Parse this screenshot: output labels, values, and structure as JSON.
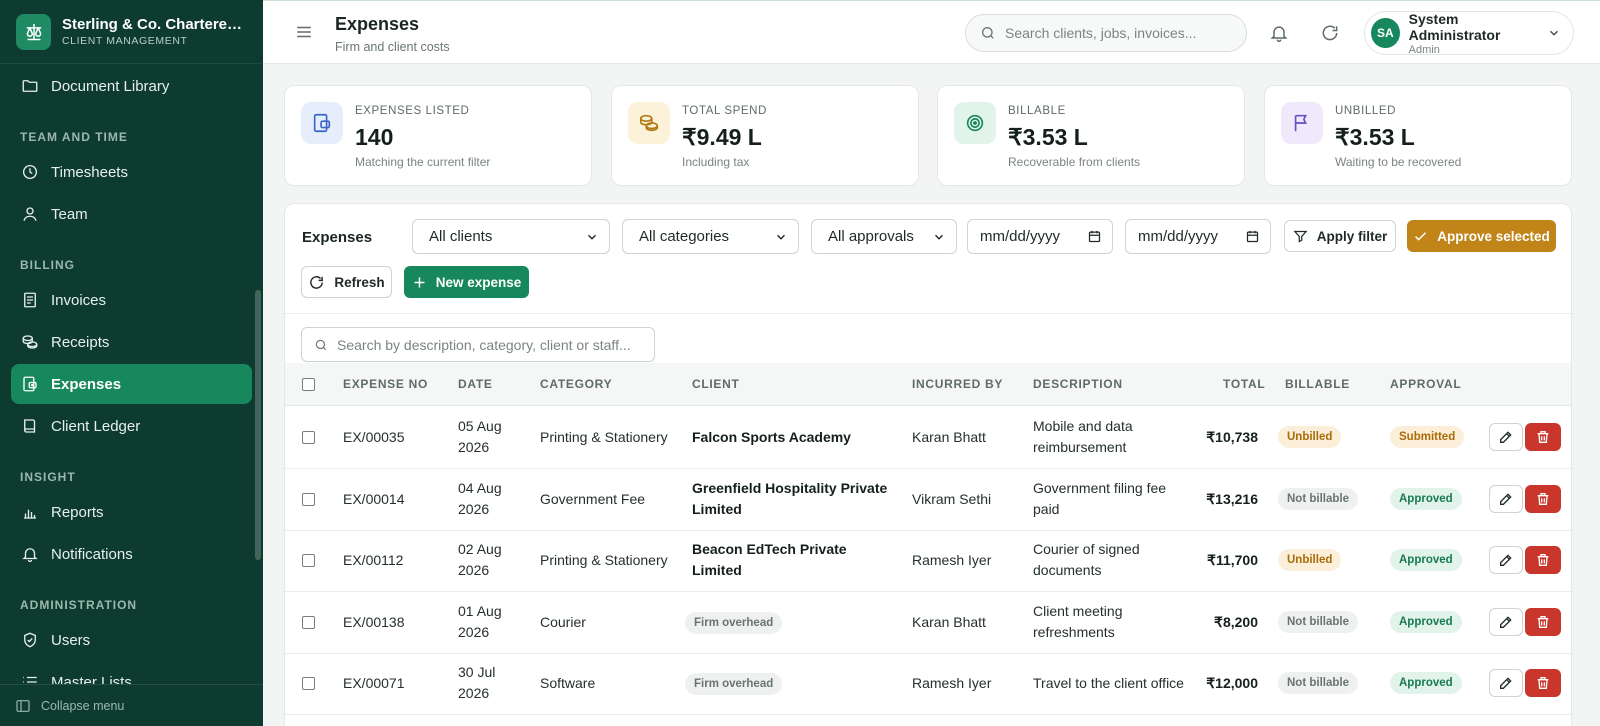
{
  "brand": {
    "title": "Sterling & Co. Chartered Accountants",
    "subtitle": "CLIENT MANAGEMENT"
  },
  "sidebar": {
    "top_item": {
      "label": "Document Library",
      "icon": "folder-icon"
    },
    "sections": [
      {
        "heading": "TEAM AND TIME",
        "items": [
          {
            "label": "Timesheets",
            "icon": "clock-icon"
          },
          {
            "label": "Team",
            "icon": "user-icon"
          }
        ]
      },
      {
        "heading": "BILLING",
        "items": [
          {
            "label": "Invoices",
            "icon": "invoice-icon"
          },
          {
            "label": "Receipts",
            "icon": "coins-icon"
          },
          {
            "label": "Expenses",
            "icon": "wallet-icon",
            "active": true
          },
          {
            "label": "Client Ledger",
            "icon": "book-icon"
          }
        ]
      },
      {
        "heading": "INSIGHT",
        "items": [
          {
            "label": "Reports",
            "icon": "bar-chart-icon"
          },
          {
            "label": "Notifications",
            "icon": "bell-icon"
          }
        ]
      },
      {
        "heading": "ADMINISTRATION",
        "items": [
          {
            "label": "Users",
            "icon": "shield-icon"
          },
          {
            "label": "Master Lists",
            "icon": "list-icon"
          }
        ]
      }
    ],
    "collapse_label": "Collapse menu"
  },
  "header": {
    "title": "Expenses",
    "subtitle": "Firm and client costs",
    "search_placeholder": "Search clients, jobs, invoices...",
    "user_name": "System Administrator",
    "user_role": "Admin",
    "user_initials": "SA"
  },
  "stats": [
    {
      "label": "EXPENSES LISTED",
      "value": "140",
      "note": "Matching the current filter",
      "icon": "wallet-icon",
      "tint": "#e6eefc",
      "color": "#3a64c8"
    },
    {
      "label": "TOTAL SPEND",
      "value": "₹9.49 L",
      "note": "Including tax",
      "icon": "coins-icon",
      "tint": "#fcf1d9",
      "color": "#b07a12"
    },
    {
      "label": "BILLABLE",
      "value": "₹3.53 L",
      "note": "Recoverable from clients",
      "icon": "target-icon",
      "tint": "#e1f3ea",
      "color": "#17875e"
    },
    {
      "label": "UNBILLED",
      "value": "₹3.53 L",
      "note": "Waiting to be recovered",
      "icon": "flag-icon",
      "tint": "#efe9fb",
      "color": "#6a4fc4"
    }
  ],
  "filters": {
    "panel_title": "Expenses",
    "client": "All clients",
    "category": "All categories",
    "approval": "All approvals",
    "date_from": "mm/dd/yyyy",
    "date_to": "mm/dd/yyyy",
    "apply_label": "Apply filter",
    "approve_label": "Approve selected",
    "refresh_label": "Refresh",
    "new_label": "New expense",
    "search_placeholder": "Search by description, category, client or staff..."
  },
  "table": {
    "columns": {
      "expense_no": "EXPENSE NO",
      "date": "DATE",
      "category": "CATEGORY",
      "client": "CLIENT",
      "incurred_by": "INCURRED BY",
      "description": "DESCRIPTION",
      "total": "TOTAL",
      "billable": "BILLABLE",
      "approval": "APPROVAL"
    },
    "rows": [
      {
        "no": "EX/00035",
        "date1": "05 Aug",
        "date2": "2026",
        "category": "Printing & Stationery",
        "client1": "Falcon Sports Academy",
        "client2": "",
        "client_overhead": false,
        "by": "Karan Bhatt",
        "desc1": "Mobile and data",
        "desc2": "reimbursement",
        "total": "₹10,738",
        "billable": "Unbilled",
        "billable_kind": "unbilled",
        "approval": "Submitted",
        "approval_kind": "submitted"
      },
      {
        "no": "EX/00014",
        "date1": "04 Aug",
        "date2": "2026",
        "category": "Government Fee",
        "client1": "Greenfield Hospitality Private",
        "client2": "Limited",
        "client_overhead": false,
        "by": "Vikram Sethi",
        "desc1": "Government filing fee",
        "desc2": "paid",
        "total": "₹13,216",
        "billable": "Not billable",
        "billable_kind": "notbill",
        "approval": "Approved",
        "approval_kind": "approved"
      },
      {
        "no": "EX/00112",
        "date1": "02 Aug",
        "date2": "2026",
        "category": "Printing & Stationery",
        "client1": "Beacon EdTech Private",
        "client2": "Limited",
        "client_overhead": false,
        "by": "Ramesh Iyer",
        "desc1": "Courier of signed",
        "desc2": "documents",
        "total": "₹11,700",
        "billable": "Unbilled",
        "billable_kind": "unbilled",
        "approval": "Approved",
        "approval_kind": "approved"
      },
      {
        "no": "EX/00138",
        "date1": "01 Aug",
        "date2": "2026",
        "category": "Courier",
        "client1": "Firm overhead",
        "client2": "",
        "client_overhead": true,
        "by": "Karan Bhatt",
        "desc1": "Client meeting",
        "desc2": "refreshments",
        "total": "₹8,200",
        "billable": "Not billable",
        "billable_kind": "notbill",
        "approval": "Approved",
        "approval_kind": "approved"
      },
      {
        "no": "EX/00071",
        "date1": "30 Jul",
        "date2": "2026",
        "category": "Software",
        "client1": "Firm overhead",
        "client2": "",
        "client_overhead": true,
        "by": "Ramesh Iyer",
        "desc1": "Travel to the client office",
        "desc2": "",
        "total": "₹12,000",
        "billable": "Not billable",
        "billable_kind": "notbill",
        "approval": "Approved",
        "approval_kind": "approved"
      }
    ]
  }
}
